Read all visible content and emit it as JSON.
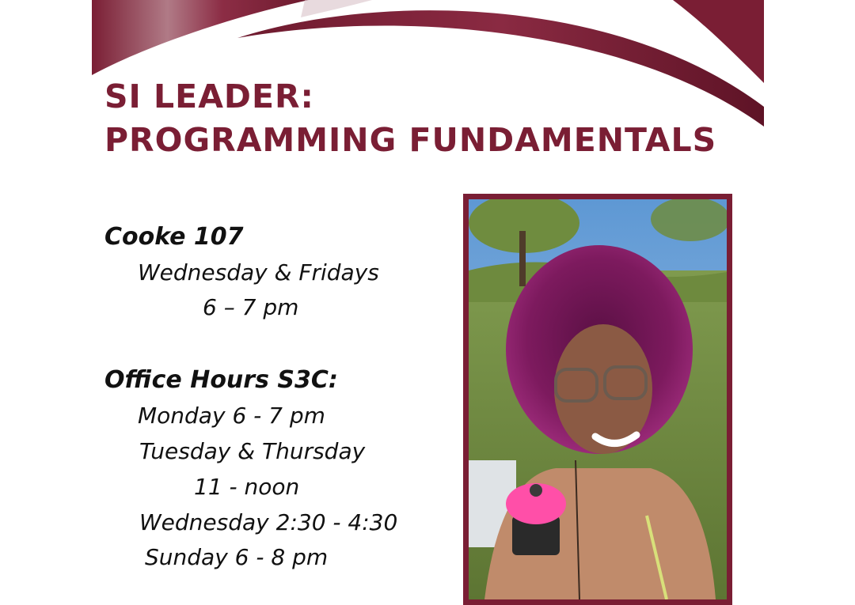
{
  "title": {
    "line1": "SI LEADER:",
    "line2": "PROGRAMMING FUNDAMENTALS"
  },
  "schedule": {
    "location": "Cooke 107",
    "location_days": "Wednesday & Fridays",
    "location_time": "6 – 7 pm",
    "office_hours_heading": "Office Hours S3C:",
    "office_hours": [
      "Monday 6 - 7 pm",
      "Tuesday & Thursday",
      "11 - noon",
      "Wednesday 2:30 - 4:30",
      "Sunday 6 - 8 pm"
    ]
  },
  "colors": {
    "brand": "#7a1e34",
    "text": "#111111",
    "background": "#ffffff"
  },
  "photo": {
    "icon": "portrait-photo"
  }
}
